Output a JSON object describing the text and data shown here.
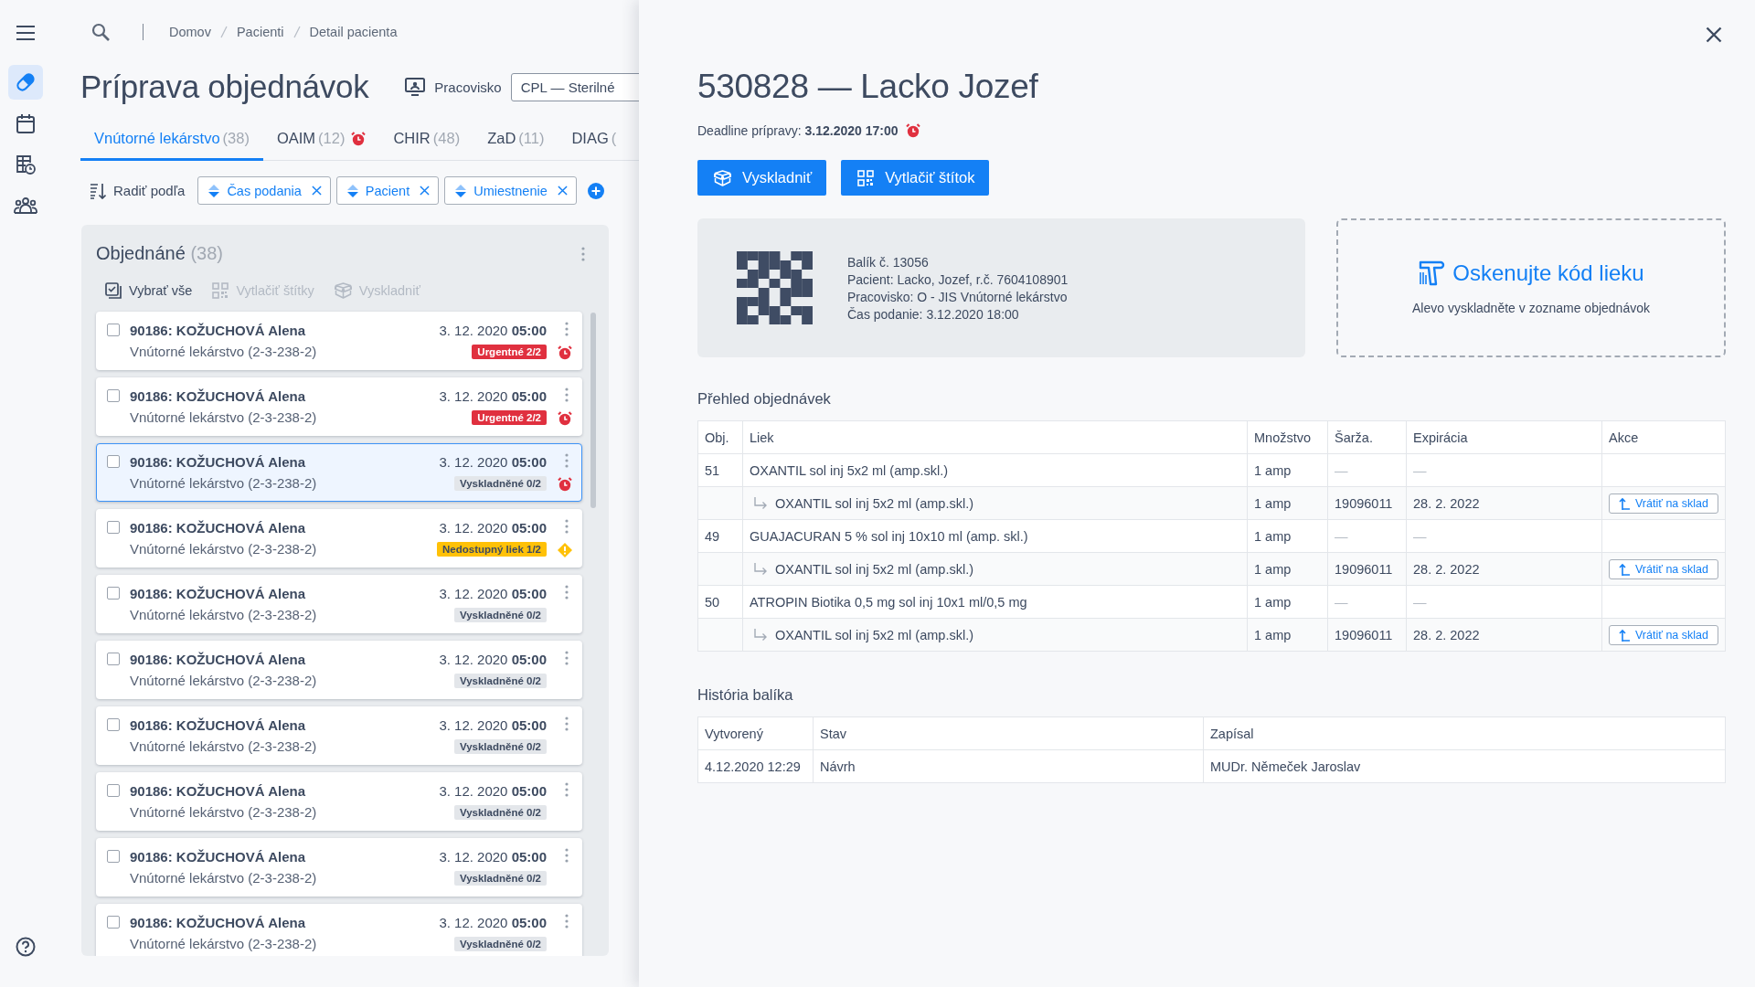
{
  "sidebar": {
    "items": [
      {
        "kind": "medication",
        "selected": true
      },
      {
        "kind": "calendar",
        "selected": false
      },
      {
        "kind": "schedule",
        "selected": false
      },
      {
        "kind": "people",
        "selected": false
      }
    ]
  },
  "breadcrumb": [
    "Domov",
    "Pacienti",
    "Detail pacienta"
  ],
  "page_title": "Príprava objednávok",
  "workplace": {
    "label": "Pracovisko",
    "value": "CPL — Sterilné"
  },
  "tabs": [
    {
      "label": "Vnútorné lekárstvo",
      "count": "(38)",
      "selected": true,
      "alarm": false
    },
    {
      "label": "OAIM",
      "count": "(12)",
      "selected": false,
      "alarm": true
    },
    {
      "label": "CHIR",
      "count": "(48)",
      "selected": false,
      "alarm": false
    },
    {
      "label": "ZaD",
      "count": "(11)",
      "selected": false,
      "alarm": false
    },
    {
      "label": "DIAG",
      "count": "(",
      "selected": false,
      "alarm": false
    }
  ],
  "sort": {
    "label": "Radiť podľa",
    "chips": [
      "Čas podania",
      "Pacient",
      "Umiestnenie"
    ]
  },
  "order_list": {
    "title": "Objednáné",
    "count": "(38)",
    "actions": [
      {
        "label": "Vybrať vše",
        "kind": "select_all",
        "disabled": false
      },
      {
        "label": "Vytlačiť štítky",
        "kind": "print",
        "disabled": true
      },
      {
        "label": "Vyskladniť",
        "kind": "dispense",
        "disabled": true
      }
    ],
    "cards": [
      {
        "patient": "90186: KOŽUCHOVÁ Alena",
        "ward": "Vnútorné lekárstvo (2-3-238-2)",
        "when": "3. 12. 2020 **05:00**",
        "badge": {
          "text": "Urgentné 2/2",
          "kind": "urgent"
        },
        "alert": {
          "kind": "alarm"
        },
        "checked": false,
        "selected": false
      },
      {
        "patient": "90186: KOŽUCHOVÁ Alena",
        "ward": "Vnútorné lekárstvo (2-3-238-2)",
        "when": "3. 12. 2020 **05:00**",
        "badge": {
          "text": "Urgentné 2/2",
          "kind": "urgent"
        },
        "alert": {
          "kind": "alarm"
        },
        "checked": false,
        "selected": false
      },
      {
        "patient": "90186: KOŽUCHOVÁ Alena",
        "ward": "Vnútorné lekárstvo (2-3-238-2)",
        "when": "3. 12. 2020 **05:00**",
        "badge": {
          "text": "Vyskladněné 0/2",
          "kind": "neutral"
        },
        "alert": {
          "kind": "alarm"
        },
        "checked": false,
        "selected": true
      },
      {
        "patient": "90186: KOŽUCHOVÁ Alena",
        "ward": "Vnútorné lekárstvo (2-3-238-2)",
        "when": "3. 12. 2020 **05:00**",
        "badge": {
          "text": "Nedostupný liek 1/2",
          "kind": "warning"
        },
        "alert": {
          "kind": "warning"
        },
        "checked": false,
        "selected": false
      },
      {
        "patient": "90186: KOŽUCHOVÁ Alena",
        "ward": "Vnútorné lekárstvo (2-3-238-2)",
        "when": "3. 12. 2020 **05:00**",
        "badge": {
          "text": "Vyskladněné 0/2",
          "kind": "neutral"
        },
        "checked": false,
        "selected": false
      },
      {
        "patient": "90186: KOŽUCHOVÁ Alena",
        "ward": "Vnútorné lekárstvo (2-3-238-2)",
        "when": "3. 12. 2020 **05:00**",
        "badge": {
          "text": "Vyskladněné 0/2",
          "kind": "neutral"
        },
        "checked": false,
        "selected": false
      },
      {
        "patient": "90186: KOŽUCHOVÁ Alena",
        "ward": "Vnútorné lekárstvo (2-3-238-2)",
        "when": "3. 12. 2020 **05:00**",
        "badge": {
          "text": "Vyskladněné 0/2",
          "kind": "neutral"
        },
        "checked": false,
        "selected": false
      },
      {
        "patient": "90186: KOŽUCHOVÁ Alena",
        "ward": "Vnútorné lekárstvo (2-3-238-2)",
        "when": "3. 12. 2020 **05:00**",
        "badge": {
          "text": "Vyskladněné 0/2",
          "kind": "neutral"
        },
        "checked": false,
        "selected": false
      },
      {
        "patient": "90186: KOŽUCHOVÁ Alena",
        "ward": "Vnútorné lekárstvo (2-3-238-2)",
        "when": "3. 12. 2020 **05:00**",
        "badge": {
          "text": "Vyskladněné 0/2",
          "kind": "neutral"
        },
        "checked": false,
        "selected": false
      },
      {
        "patient": "90186: KOŽUCHOVÁ Alena",
        "ward": "Vnútorné lekárstvo (2-3-238-2)",
        "when": "3. 12. 2020 **05:00**",
        "badge": {
          "text": "Vyskladněné 0/2",
          "kind": "neutral"
        },
        "checked": false,
        "selected": false
      }
    ]
  },
  "detail": {
    "title": "530828 — Lacko Jozef",
    "deadline": "Deadline prípravy: **3.12.2020 17:00**",
    "deadline_alarm": true,
    "buttons": [
      {
        "label": "Vyskladniť",
        "kind": "dispense"
      },
      {
        "label": "Vytlačiť štítok",
        "kind": "print"
      }
    ],
    "package": [
      "Balík č. 13056",
      "Pacient: Lacko, Jozef, r.č. 7604108901",
      "Pracovisko: O - JIS Vnútorné lekárstvo",
      "Čas podanie: 3.12.2020 18:00"
    ],
    "scan": {
      "title": "Oskenujte kód lieku",
      "hint": "Alevo vyskladněte v zozname objednávok"
    },
    "orders": {
      "title": "Přehled objednávek",
      "columns": [
        "Obj.",
        "Liek",
        "Množstvo",
        "Šarža.",
        "Expirácia",
        "Akce"
      ],
      "rows": [
        {
          "obj": "51",
          "drug": "OXANTIL sol inj 5x2 ml (amp.skl.)",
          "quantity": "1 amp",
          "batch": "—",
          "expiry": "—",
          "children": [
            {
              "drug": "OXANTIL sol inj 5x2 ml (amp.skl.)",
              "quantity": "1 amp",
              "batch": "19096011",
              "expiry": "28. 2. 2022",
              "action": "Vrátiť na sklad"
            }
          ]
        },
        {
          "obj": "49",
          "drug": "GUAJACURAN 5 % sol inj 10x10 ml (amp. skl.)",
          "quantity": "1 amp",
          "batch": "—",
          "expiry": "—",
          "children": [
            {
              "drug": "OXANTIL sol inj 5x2 ml (amp.skl.)",
              "quantity": "1 amp",
              "batch": "19096011",
              "expiry": "28. 2. 2022",
              "action": "Vrátiť na sklad"
            }
          ]
        },
        {
          "obj": "50",
          "drug": "ATROPIN Biotika 0,5 mg sol inj 10x1 ml/0,5 mg",
          "quantity": "1 amp",
          "batch": "—",
          "expiry": "—",
          "children": [
            {
              "drug": "OXANTIL sol inj 5x2 ml (amp.skl.)",
              "quantity": "1 amp",
              "batch": "19096011",
              "expiry": "28. 2. 2022",
              "action": "Vrátiť na sklad"
            }
          ]
        }
      ]
    },
    "history": {
      "title": "História balíka",
      "columns": [
        "Vytvorený",
        "Stav",
        "Zapísal"
      ],
      "rows": [
        [
          "4.12.2020 12:29",
          "Návrh",
          "MUDr. Němeček Jaroslav"
        ]
      ]
    }
  }
}
